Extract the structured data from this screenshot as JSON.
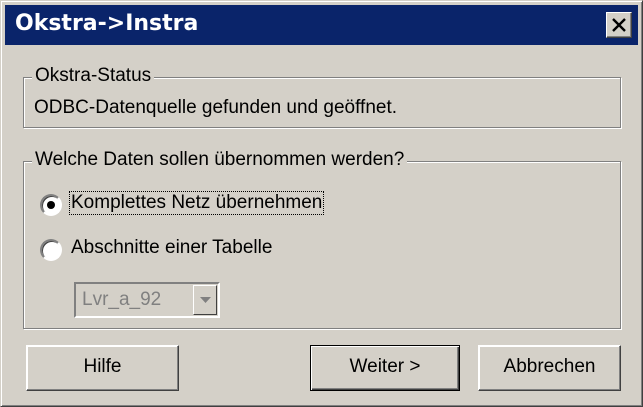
{
  "window": {
    "title": "Okstra->Instra"
  },
  "status_group": {
    "legend": "Okstra-Status",
    "text": "ODBC-Datenquelle gefunden und geöffnet."
  },
  "data_group": {
    "legend": "Welche Daten sollen übernommen werden?",
    "options": [
      {
        "label": "Komplettes Netz übernehmen",
        "selected": true
      },
      {
        "label": "Abschnitte einer Tabelle",
        "selected": false
      }
    ],
    "table_select": {
      "value": "Lvr_a_92",
      "enabled": false
    }
  },
  "buttons": {
    "help": "Hilfe",
    "next": "Weiter >",
    "cancel": "Abbrechen"
  },
  "colors": {
    "titlebar": "#0a246a",
    "face": "#d4d0c8",
    "disabled_text": "#808080"
  }
}
